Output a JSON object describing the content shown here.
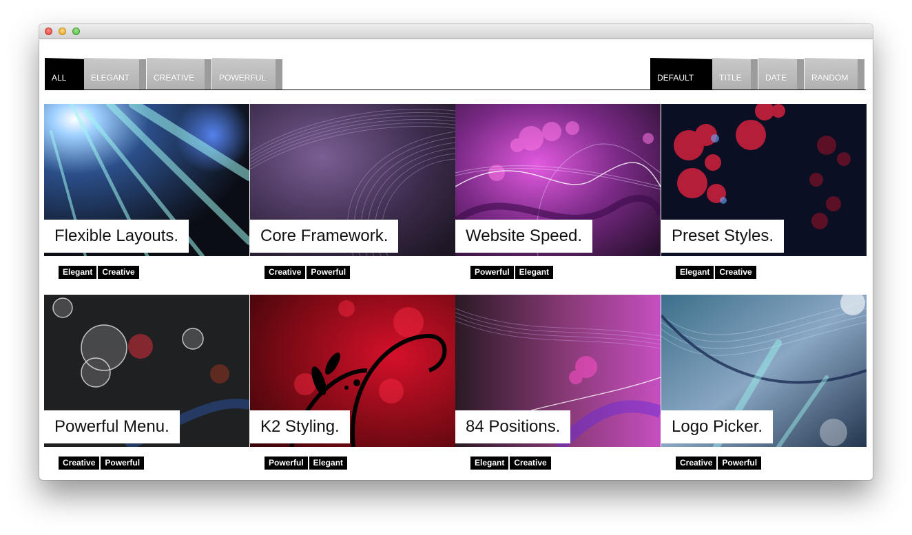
{
  "filters": {
    "items": [
      {
        "label": "ALL",
        "active": true
      },
      {
        "label": "ELEGANT",
        "active": false
      },
      {
        "label": "CREATIVE",
        "active": false
      },
      {
        "label": "POWERFUL",
        "active": false
      }
    ]
  },
  "sort": {
    "items": [
      {
        "label": "DEFAULT",
        "active": true
      },
      {
        "label": "TITLE",
        "active": false
      },
      {
        "label": "DATE",
        "active": false
      },
      {
        "label": "RANDOM",
        "active": false
      }
    ]
  },
  "cards": [
    {
      "title": "Flexible Layouts.",
      "tags": [
        "Elegant",
        "Creative"
      ]
    },
    {
      "title": "Core Framework.",
      "tags": [
        "Creative",
        "Powerful"
      ]
    },
    {
      "title": "Website Speed.",
      "tags": [
        "Powerful",
        "Elegant"
      ]
    },
    {
      "title": "Preset Styles.",
      "tags": [
        "Elegant",
        "Creative"
      ]
    },
    {
      "title": "Powerful Menu.",
      "tags": [
        "Creative",
        "Powerful"
      ]
    },
    {
      "title": "K2 Styling.",
      "tags": [
        "Powerful",
        "Elegant"
      ]
    },
    {
      "title": "84 Positions.",
      "tags": [
        "Elegant",
        "Creative"
      ]
    },
    {
      "title": "Logo Picker.",
      "tags": [
        "Creative",
        "Powerful"
      ]
    }
  ],
  "colors": {
    "active_tab": "#000000",
    "inactive_tab": "#bcbcbc",
    "tag_bg": "#000000"
  }
}
